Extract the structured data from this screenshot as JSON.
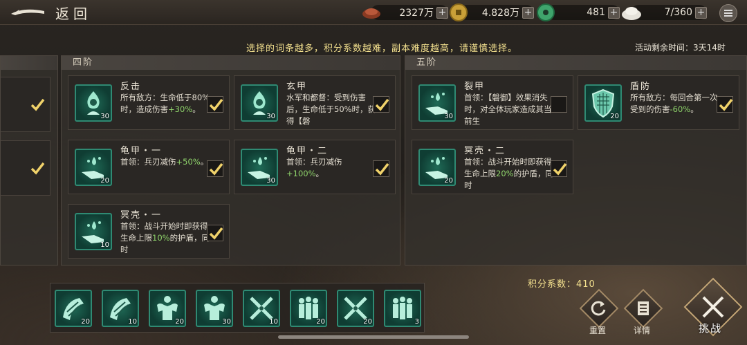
{
  "header": {
    "back_label": "返回",
    "resources": [
      {
        "icon": "copper-ingot-icon",
        "value": "2327万"
      },
      {
        "icon": "gold-coin-icon",
        "value": "4.828万"
      },
      {
        "icon": "jade-coin-icon",
        "value": "481"
      },
      {
        "icon": "steamed-bun-icon",
        "value": "7/360"
      }
    ]
  },
  "notice": "选择的词条越多，积分系数越难，副本难度越高，请谨慎选择。",
  "timer": "活动剩余时间：3天14时",
  "tier4": {
    "title": "四阶",
    "cards": [
      {
        "title": "反击",
        "desc_pre": "所有敌方：生命低于80%时，造成伤害",
        "desc_green": "+30%",
        "desc_post": "。",
        "count": "30",
        "checked": true,
        "icon": "flame-figure-icon"
      },
      {
        "title": "玄甲",
        "desc_pre": "水军和都督：受到伤害后，生命低于50%时，获得【磐",
        "desc_green": "",
        "desc_post": "",
        "count": "30",
        "checked": true,
        "icon": "flame-figure-icon"
      },
      {
        "title": "龟甲・一",
        "desc_pre": "首领：兵刃减伤",
        "desc_green": "+50%",
        "desc_post": "。",
        "count": "20",
        "checked": true,
        "icon": "hand-drop-icon"
      },
      {
        "title": "龟甲・二",
        "desc_pre": "首领：兵刃减伤",
        "desc_green": "+100%",
        "desc_post": "。",
        "count": "30",
        "checked": true,
        "icon": "hand-drop-icon"
      },
      {
        "title": "冥壳・一",
        "desc_pre": "首领：战斗开始时即获得生命上限",
        "desc_green": "10%",
        "desc_post": "的护盾，同时",
        "count": "10",
        "checked": true,
        "icon": "hand-drop-icon"
      }
    ]
  },
  "tier5": {
    "title": "五阶",
    "cards": [
      {
        "title": "裂甲",
        "desc_pre": "首领：【磐御】效果消失时，对全体玩家造成其当前生",
        "desc_green": "",
        "desc_post": "",
        "count": "30",
        "checked": false,
        "icon": "hand-drop-icon"
      },
      {
        "title": "盾防",
        "desc_pre": "所有敌方：每回合第一次受到的伤害",
        "desc_green": "-60%",
        "desc_post": "。",
        "count": "20",
        "checked": true,
        "icon": "shield-icon"
      },
      {
        "title": "冥壳・二",
        "desc_pre": "首领：战斗开始时即获得生命上限",
        "desc_green": "20%",
        "desc_post": "的护盾，同时",
        "count": "20",
        "checked": true,
        "icon": "hand-drop-icon"
      }
    ]
  },
  "tray": [
    {
      "icon": "arm-guard-icon",
      "count": "20"
    },
    {
      "icon": "arm-guard-icon",
      "count": "10"
    },
    {
      "icon": "strong-body-icon",
      "count": "20"
    },
    {
      "icon": "strong-body-icon",
      "count": "30"
    },
    {
      "icon": "crossed-swords-icon",
      "count": "10"
    },
    {
      "icon": "soldiers-icon",
      "count": "20"
    },
    {
      "icon": "crossed-swords-icon",
      "count": "20"
    },
    {
      "icon": "soldiers-icon",
      "count": "3"
    }
  ],
  "score_label": "积分系数：410",
  "actions": {
    "reset_label": "重置",
    "detail_label": "详情",
    "challenge_label": "挑战"
  }
}
